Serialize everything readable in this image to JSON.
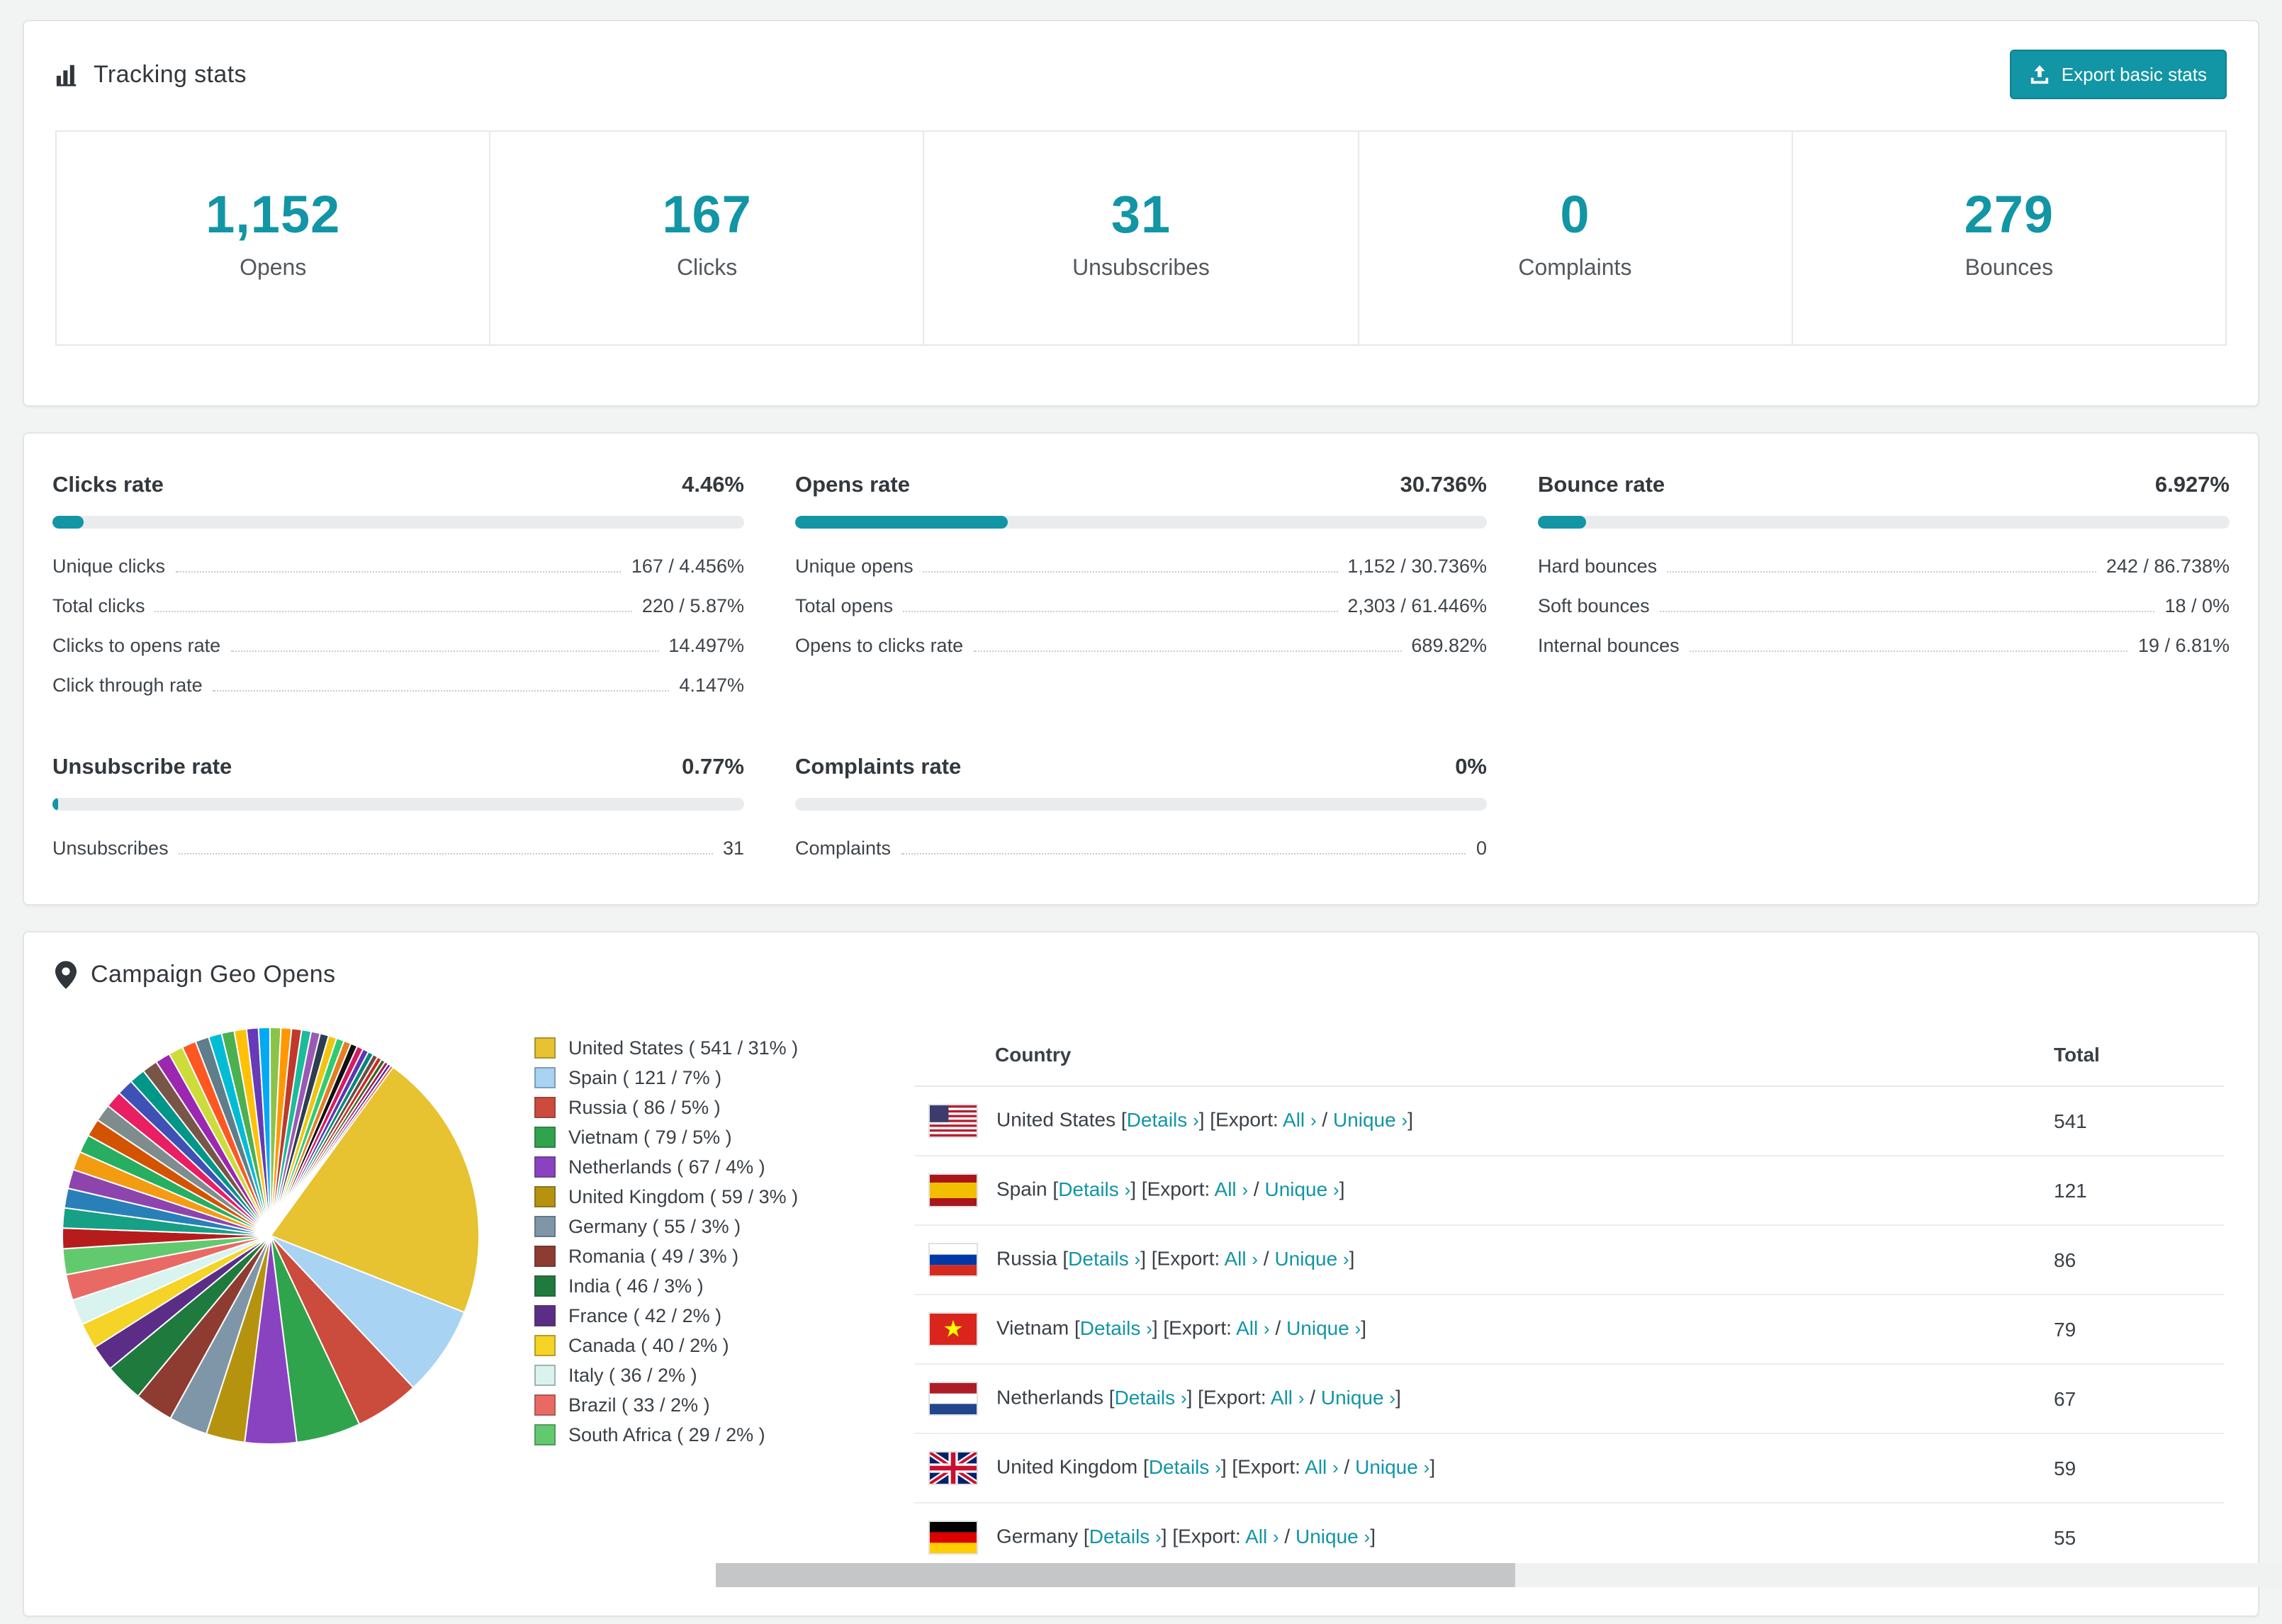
{
  "colors": {
    "accent": "#1295a5"
  },
  "tracking": {
    "title": "Tracking stats",
    "export_button": "Export basic stats",
    "stats": [
      {
        "value": "1,152",
        "label": "Opens"
      },
      {
        "value": "167",
        "label": "Clicks"
      },
      {
        "value": "31",
        "label": "Unsubscribes"
      },
      {
        "value": "0",
        "label": "Complaints"
      },
      {
        "value": "279",
        "label": "Bounces"
      }
    ]
  },
  "rates": [
    {
      "title": "Clicks rate",
      "value": "4.46%",
      "pct": 4.46,
      "rows": [
        {
          "label": "Unique clicks",
          "value": "167 / 4.456%"
        },
        {
          "label": "Total clicks",
          "value": "220 / 5.87%"
        },
        {
          "label": "Clicks to opens rate",
          "value": "14.497%"
        },
        {
          "label": "Click through rate",
          "value": "4.147%"
        }
      ]
    },
    {
      "title": "Opens rate",
      "value": "30.736%",
      "pct": 30.736,
      "rows": [
        {
          "label": "Unique opens",
          "value": "1,152 / 30.736%"
        },
        {
          "label": "Total opens",
          "value": "2,303 / 61.446%"
        },
        {
          "label": "Opens to clicks rate",
          "value": "689.82%"
        }
      ]
    },
    {
      "title": "Bounce rate",
      "value": "6.927%",
      "pct": 6.927,
      "rows": [
        {
          "label": "Hard bounces",
          "value": "242 / 86.738%"
        },
        {
          "label": "Soft bounces",
          "value": "18 / 0%"
        },
        {
          "label": "Internal bounces",
          "value": "19 / 6.81%"
        }
      ]
    },
    {
      "title": "Unsubscribe rate",
      "value": "0.77%",
      "pct": 0.77,
      "rows": [
        {
          "label": "Unsubscribes",
          "value": "31"
        }
      ]
    },
    {
      "title": "Complaints rate",
      "value": "0%",
      "pct": 0,
      "rows": [
        {
          "label": "Complaints",
          "value": "0"
        }
      ]
    }
  ],
  "geo": {
    "title": "Campaign Geo Opens",
    "table": {
      "headers": {
        "country": "Country",
        "total": "Total"
      },
      "details_label": "Details",
      "export_prefix": "Export:",
      "all_label": "All",
      "unique_label": "Unique",
      "rows": [
        {
          "country": "United States",
          "flag": "us",
          "total": "541"
        },
        {
          "country": "Spain",
          "flag": "es",
          "total": "121"
        },
        {
          "country": "Russia",
          "flag": "ru",
          "total": "86"
        },
        {
          "country": "Vietnam",
          "flag": "vn",
          "total": "79"
        },
        {
          "country": "Netherlands",
          "flag": "nl",
          "total": "67"
        },
        {
          "country": "United Kingdom",
          "flag": "gb",
          "total": "59"
        },
        {
          "country": "Germany",
          "flag": "de",
          "total": "55"
        }
      ]
    }
  },
  "chart_data": {
    "type": "pie",
    "title": "Campaign Geo Opens",
    "labels": [
      "United States",
      "Spain",
      "Russia",
      "Vietnam",
      "Netherlands",
      "United Kingdom",
      "Germany",
      "Romania",
      "India",
      "France",
      "Canada",
      "Italy",
      "Brazil",
      "South Africa"
    ],
    "values": [
      541,
      121,
      86,
      79,
      67,
      59,
      55,
      49,
      46,
      42,
      40,
      36,
      33,
      29
    ],
    "pcts": [
      31,
      7,
      5,
      5,
      4,
      3,
      3,
      3,
      3,
      2,
      2,
      2,
      2,
      2
    ],
    "colors": [
      "#e7c231",
      "#a8d3f2",
      "#cb4b3c",
      "#2fa44d",
      "#8a43c0",
      "#b6930e",
      "#7f96a8",
      "#8e3b32",
      "#1f7a3d",
      "#5b2d86",
      "#f5d327",
      "#d9f3ef",
      "#e96a64",
      "#63c96f"
    ],
    "others_pct": 36,
    "others_slices": 40,
    "others_colors": [
      "#b71c1c",
      "#16a085",
      "#2980b9",
      "#8e44ad",
      "#f39c12",
      "#27ae60",
      "#d35400",
      "#7f8c8d",
      "#e91e63",
      "#3f51b5",
      "#009688",
      "#795548",
      "#9c27b0",
      "#cddc39",
      "#ff5722",
      "#607d8b",
      "#00bcd4",
      "#4caf50",
      "#ffc107",
      "#673ab7",
      "#03a9f4",
      "#8bc34a",
      "#ff9800",
      "#c0392b",
      "#1abc9c",
      "#9b59b6",
      "#2c3e50",
      "#f1c40f",
      "#2ecc71",
      "#e67e22",
      "#111111",
      "#d81b60",
      "#5e35b1",
      "#00897b",
      "#6d4c41",
      "#c62828",
      "#33691e",
      "#ad1457",
      "#4527a0",
      "#f4511e"
    ],
    "legend_position": "right"
  }
}
